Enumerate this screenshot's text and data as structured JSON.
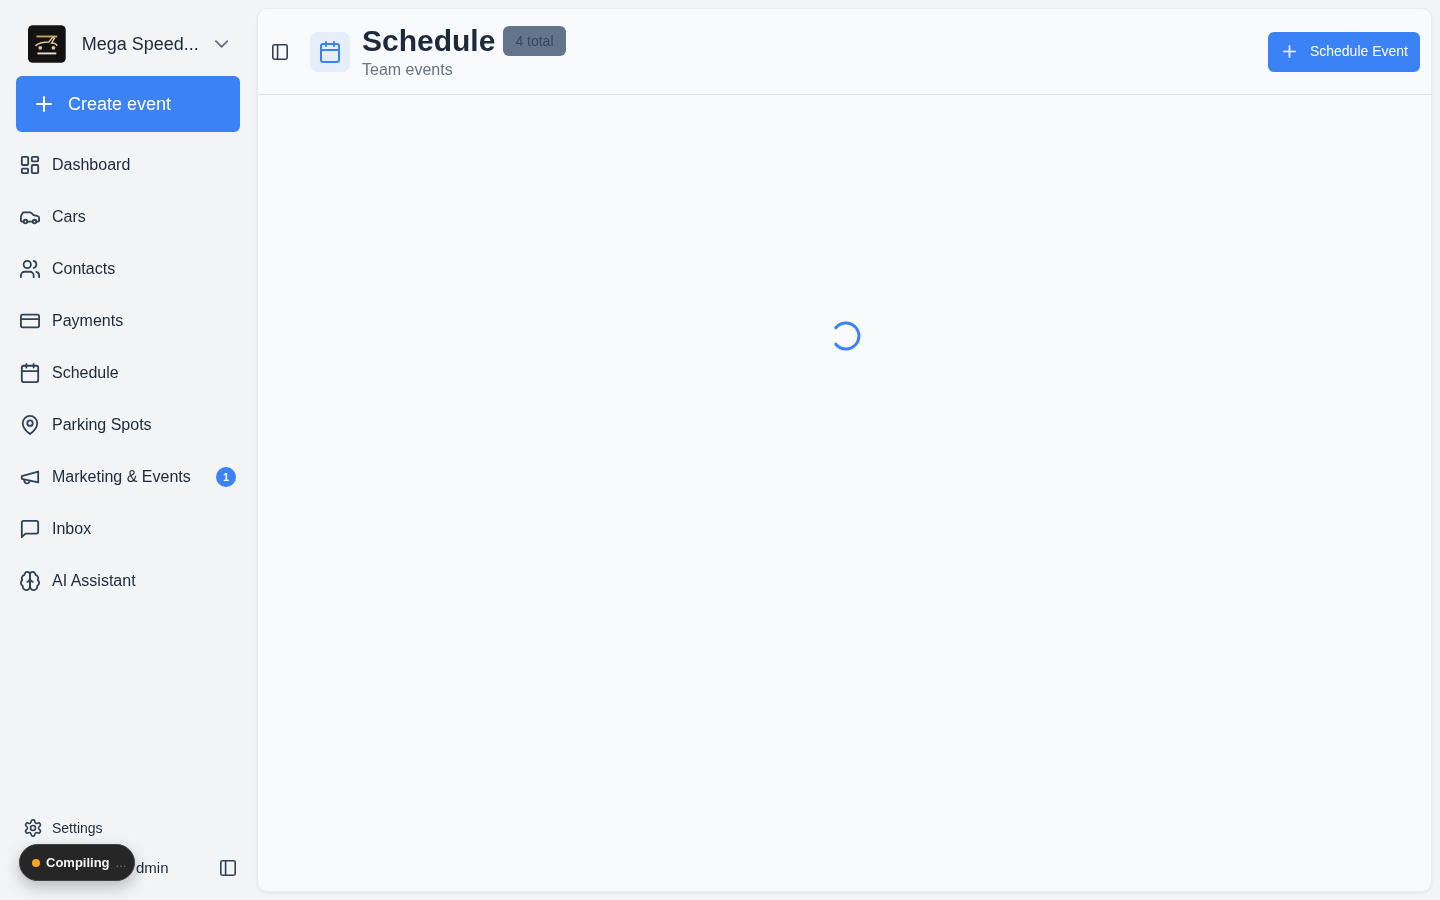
{
  "sidebar": {
    "workspace": {
      "name": "Mega Speed..."
    },
    "create_button": {
      "label": "Create event"
    },
    "items": [
      {
        "label": "Dashboard"
      },
      {
        "label": "Cars"
      },
      {
        "label": "Contacts"
      },
      {
        "label": "Payments"
      },
      {
        "label": "Schedule"
      },
      {
        "label": "Parking Spots"
      },
      {
        "label": "Marketing & Events",
        "badge": "1"
      },
      {
        "label": "Inbox"
      },
      {
        "label": "AI Assistant"
      }
    ],
    "settings": {
      "label": "Settings"
    },
    "user": {
      "name": "dmin"
    }
  },
  "toast": {
    "label": "Compiling",
    "ellipsis": "..."
  },
  "header": {
    "title": "Schedule",
    "count_badge": "4 total",
    "subtitle": "Team events",
    "action_button": {
      "label": "Schedule Event"
    }
  },
  "content": {
    "loading": true
  }
}
